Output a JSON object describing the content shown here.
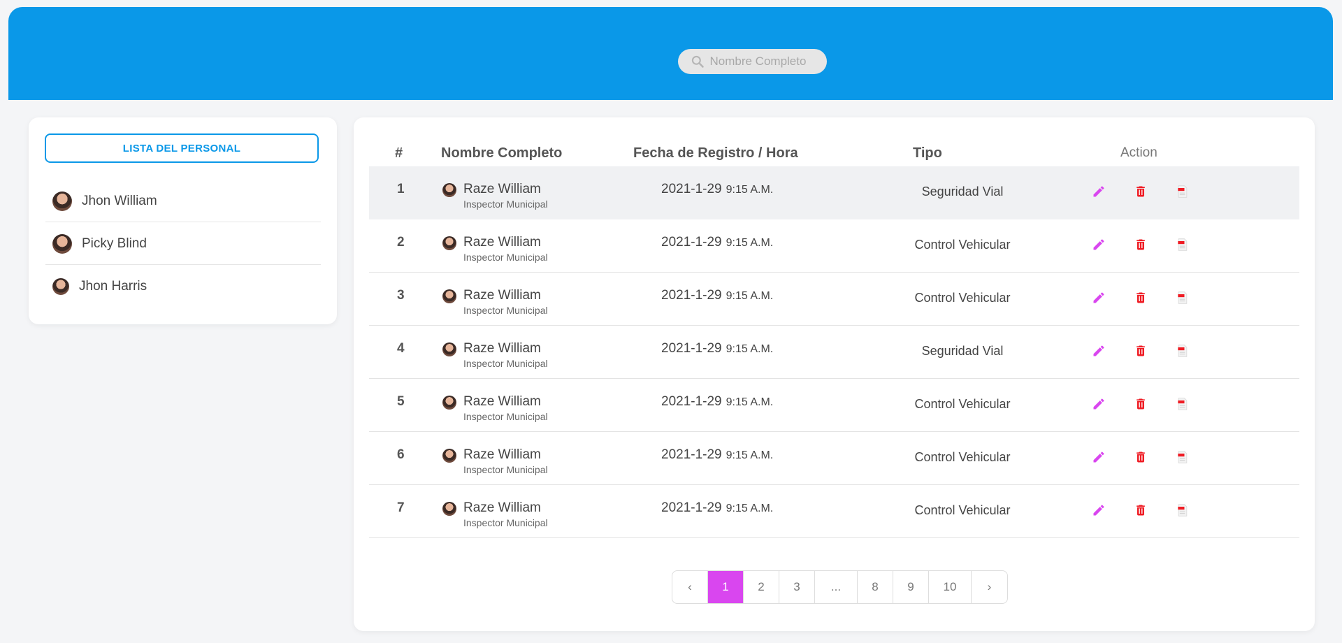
{
  "search": {
    "placeholder": "Nombre Completo"
  },
  "sidebar": {
    "title": "LISTA DEL PERSONAL",
    "people": [
      {
        "name": "Jhon William"
      },
      {
        "name": "Picky Blind"
      },
      {
        "name": "Jhon Harris"
      }
    ]
  },
  "table": {
    "headers": {
      "num": "#",
      "name": "Nombre Completo",
      "date": "Fecha de Registro / Hora",
      "type": "Tipo",
      "action": "Action"
    },
    "rows": [
      {
        "num": "1",
        "name": "Raze William",
        "role": "Inspector Municipal",
        "date": "2021-1-29",
        "time": "9:15 A.M.",
        "type": "Seguridad Vial"
      },
      {
        "num": "2",
        "name": "Raze William",
        "role": "Inspector Municipal",
        "date": "2021-1-29",
        "time": "9:15 A.M.",
        "type": "Control Vehicular"
      },
      {
        "num": "3",
        "name": "Raze William",
        "role": "Inspector Municipal",
        "date": "2021-1-29",
        "time": "9:15 A.M.",
        "type": "Control Vehicular"
      },
      {
        "num": "4",
        "name": "Raze William",
        "role": "Inspector Municipal",
        "date": "2021-1-29",
        "time": "9:15 A.M.",
        "type": "Seguridad Vial"
      },
      {
        "num": "5",
        "name": "Raze William",
        "role": "Inspector Municipal",
        "date": "2021-1-29",
        "time": "9:15 A.M.",
        "type": "Control Vehicular"
      },
      {
        "num": "6",
        "name": "Raze William",
        "role": "Inspector Municipal",
        "date": "2021-1-29",
        "time": "9:15 A.M.",
        "type": "Control Vehicular"
      },
      {
        "num": "7",
        "name": "Raze William",
        "role": "Inspector Municipal",
        "date": "2021-1-29",
        "time": "9:15 A.M.",
        "type": "Control Vehicular"
      }
    ]
  },
  "pagination": {
    "prev": "‹",
    "pages": [
      "1",
      "2",
      "3",
      "...",
      "8",
      "9",
      "10"
    ],
    "active": "1",
    "next": "›"
  },
  "colors": {
    "header": "#0a98e8",
    "accent": "#d946ef",
    "delete": "#ef1c24"
  },
  "icons": {
    "search": "search-icon",
    "edit": "pencil-icon",
    "delete": "trash-icon",
    "pdf": "pdf-icon"
  }
}
